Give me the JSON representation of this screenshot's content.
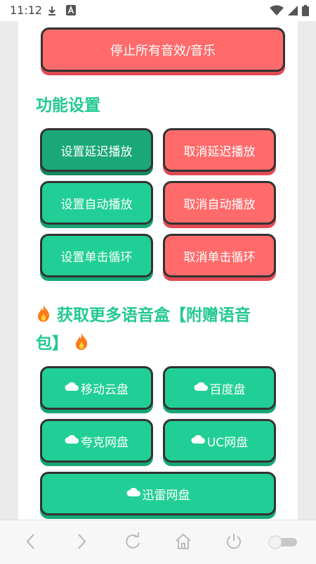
{
  "status": {
    "time": "11:12",
    "icons": [
      "download-icon",
      "a-badge-icon",
      "wifi-icon",
      "signal-icon",
      "battery-icon"
    ]
  },
  "top": {
    "stop_label": "停止所有音效/音乐"
  },
  "settings": {
    "title": "功能设置",
    "buttons": [
      {
        "label": "设置延迟播放",
        "style": "green-active"
      },
      {
        "label": "取消延迟播放",
        "style": "red"
      },
      {
        "label": "设置自动播放",
        "style": "green"
      },
      {
        "label": "取消自动播放",
        "style": "red"
      },
      {
        "label": "设置单击循环",
        "style": "green"
      },
      {
        "label": "取消单击循环",
        "style": "red"
      }
    ]
  },
  "more": {
    "title_line1": "获取更多语音盒【附赠语音",
    "title_line2": "包】",
    "fire_icon": "fire-icon",
    "links": [
      {
        "label": "移动云盘"
      },
      {
        "label": "百度盘"
      },
      {
        "label": "夸克网盘"
      },
      {
        "label": "UC网盘"
      },
      {
        "label": "迅雷网盘"
      }
    ]
  },
  "nav": {
    "icons": [
      "back-icon",
      "forward-icon",
      "refresh-icon",
      "home-icon",
      "power-icon",
      "toggle-switch"
    ]
  },
  "colors": {
    "green": "#21cf96",
    "green_active": "#1aa878",
    "red": "#ff6b6b",
    "title_green": "#22c990"
  }
}
